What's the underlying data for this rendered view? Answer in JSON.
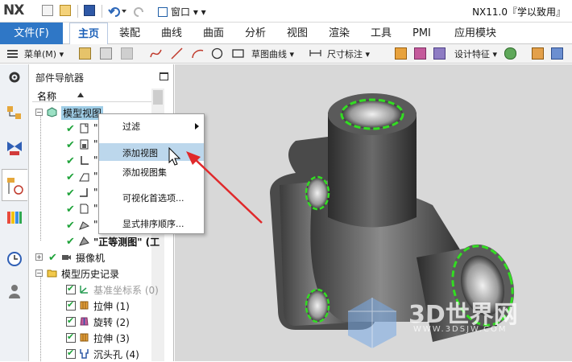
{
  "app": {
    "logo": "NX",
    "title": "NX11.0『学以致用』",
    "window_menu": "窗口"
  },
  "ribbon": {
    "file_tab": "文件(F)",
    "tabs": [
      "主页",
      "装配",
      "曲线",
      "曲面",
      "分析",
      "视图",
      "渲染",
      "工具",
      "PMI",
      "应用模块"
    ],
    "active_tab": "主页"
  },
  "toolbar": {
    "menu_label": "菜单(M)",
    "sketch_curve": "草图曲线",
    "dimension": "尺寸标注",
    "design_feature": "设计特征"
  },
  "navigator": {
    "title": "部件导航器",
    "column_name": "名称",
    "model_views_node": "模型视图",
    "view_glyphs": [
      "\"",
      "\"",
      "\"",
      "\"",
      "\"",
      "\"",
      "\""
    ],
    "iso_view": "\"正等测图\" (工",
    "camera": "摄像机",
    "history": "模型历史记录",
    "features": [
      {
        "label": "基准坐标系 (0)",
        "grayed": true
      },
      {
        "label": "拉伸 (1)",
        "grayed": false
      },
      {
        "label": "旋转 (2)",
        "grayed": false
      },
      {
        "label": "拉伸 (3)",
        "grayed": false
      },
      {
        "label": "沉头孔 (4)",
        "grayed": false
      }
    ]
  },
  "context_menu": {
    "items": [
      {
        "label": "过滤",
        "submenu": true
      },
      {
        "label": "添加视图",
        "highlighted": true
      },
      {
        "label": "添加视图集"
      },
      {
        "label": "可视化首选项..."
      },
      {
        "label": "显式排序顺序..."
      }
    ]
  },
  "watermark": {
    "text": "3D世界网",
    "url": "WWW.3DSJW.COM"
  },
  "colors": {
    "accent": "#2f77c6",
    "check": "#1fa33a",
    "highlight": "#bcd7ec",
    "arrow": "#e0292b",
    "edge_highlight": "#33dd22"
  }
}
